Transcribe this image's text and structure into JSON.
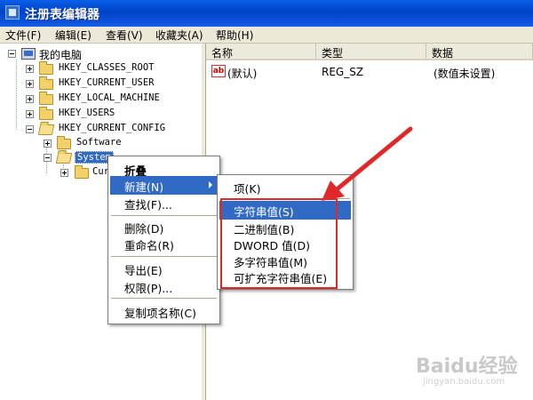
{
  "window": {
    "title": "注册表编辑器"
  },
  "menubar": [
    "文件(F)",
    "编辑(E)",
    "查看(V)",
    "收藏夹(A)",
    "帮助(H)"
  ],
  "tree": {
    "root": "我的电脑",
    "hives": [
      "HKEY_CLASSES_ROOT",
      "HKEY_CURRENT_USER",
      "HKEY_LOCAL_MACHINE",
      "HKEY_USERS",
      "HKEY_CURRENT_CONFIG"
    ],
    "config_children": [
      "Software",
      "System"
    ],
    "system_child": "Cur"
  },
  "list": {
    "columns": [
      "名称",
      "类型",
      "数据"
    ],
    "rows": [
      {
        "name": "(默认)",
        "type": "REG_SZ",
        "data": "(数值未设置)"
      }
    ]
  },
  "context_menu": [
    "折叠",
    "新建(N)",
    "查找(F)...",
    "删除(D)",
    "重命名(R)",
    "导出(E)",
    "权限(P)...",
    "复制项名称(C)"
  ],
  "submenu": [
    "项(K)",
    "字符串值(S)",
    "二进制值(B)",
    "DWORD 值(D)",
    "多字符串值(M)",
    "可扩充字符串值(E)"
  ],
  "watermark": {
    "brand": "Baidu经验",
    "url": "jingyan.baidu.com"
  },
  "colors": {
    "titlebar": "#0a52dc",
    "selection": "#316ac5",
    "highlight_box": "#e02828"
  }
}
